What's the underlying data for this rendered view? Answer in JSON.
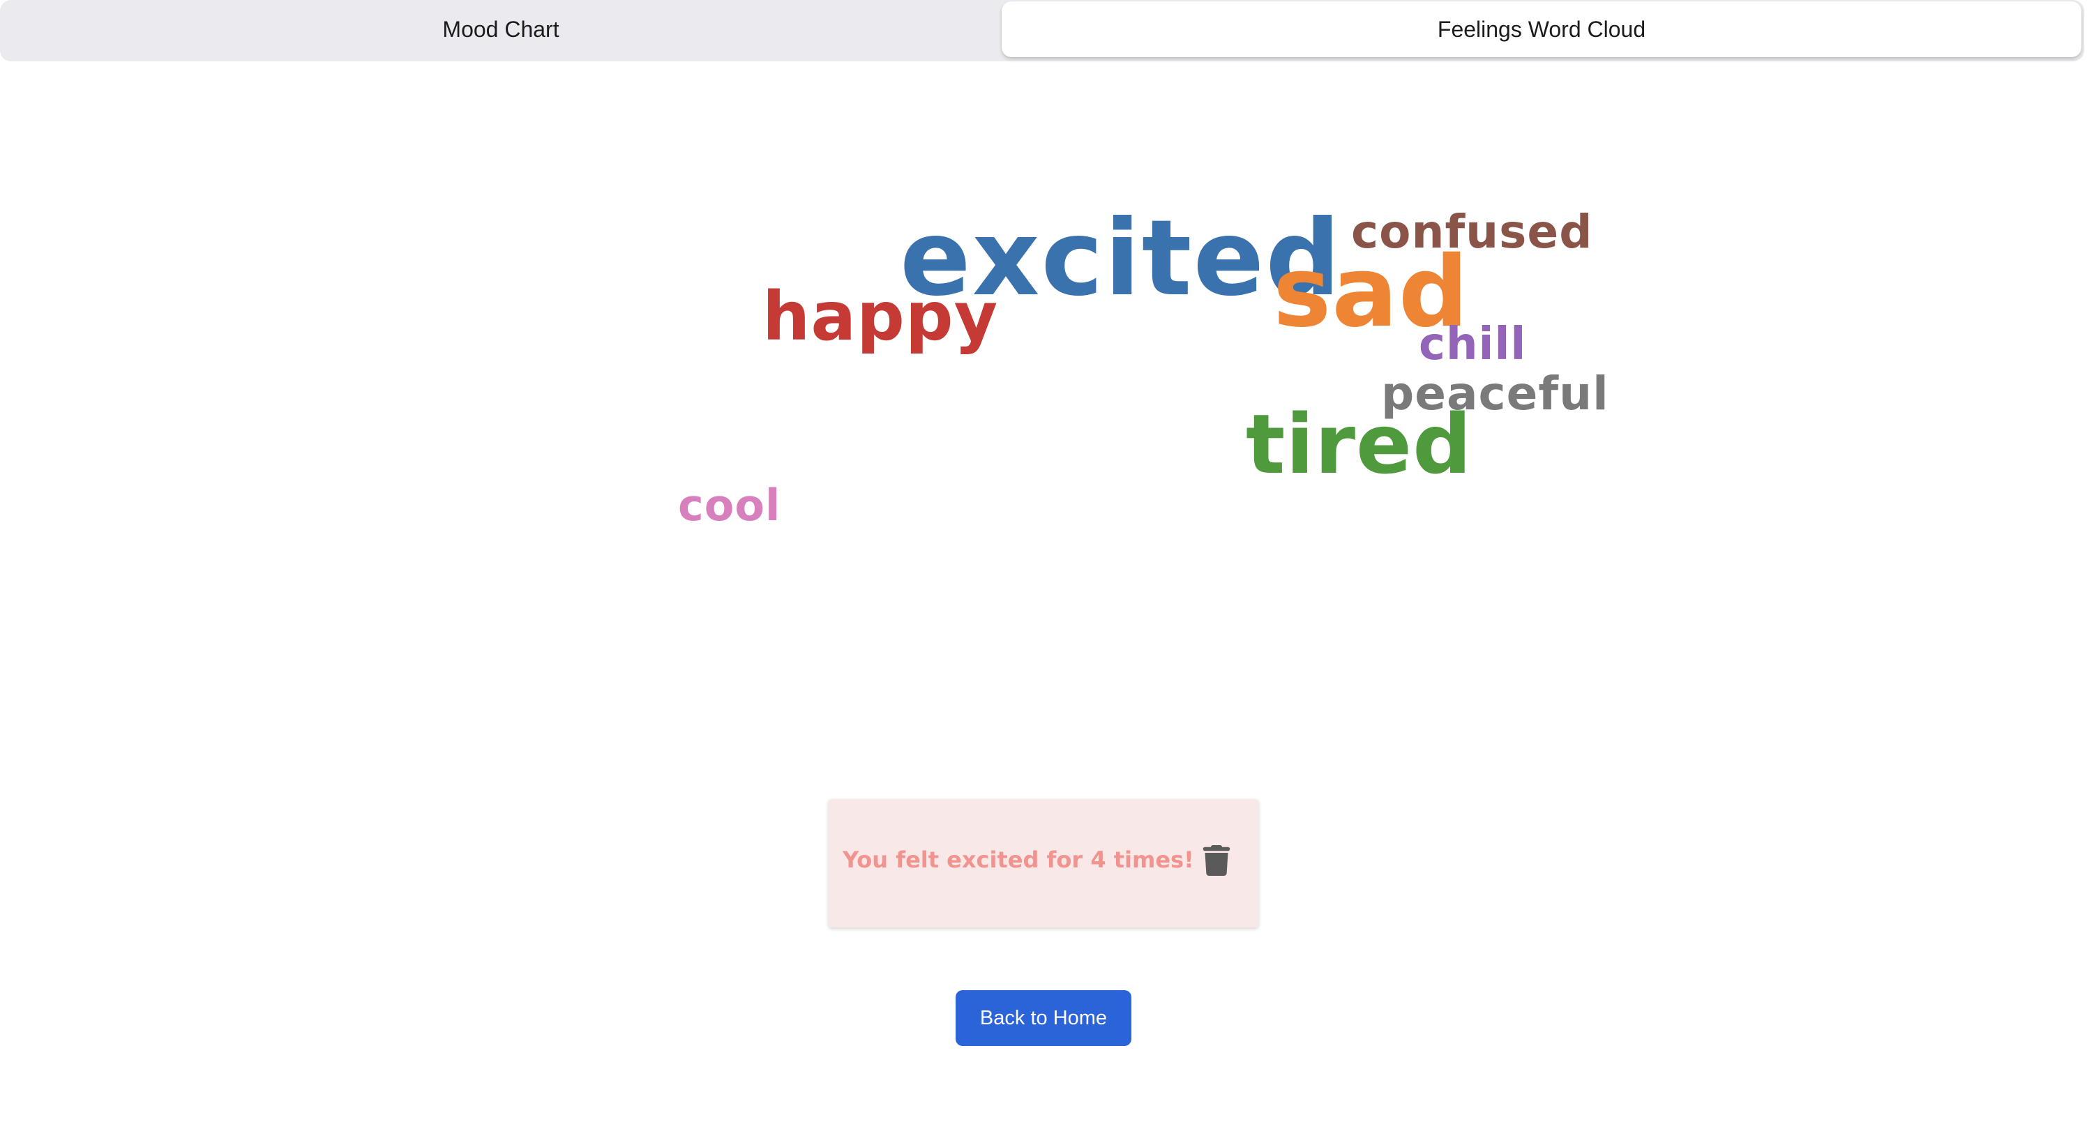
{
  "tabs": {
    "mood_chart": "Mood Chart",
    "word_cloud": "Feelings Word Cloud",
    "active": "word_cloud"
  },
  "word_cloud": {
    "words": [
      {
        "text": "excited",
        "color": "#3a72ae"
      },
      {
        "text": "sad",
        "color": "#ee8535"
      },
      {
        "text": "happy",
        "color": "#c53a35"
      },
      {
        "text": "confused",
        "color": "#8a5449"
      },
      {
        "text": "chill",
        "color": "#9364b7"
      },
      {
        "text": "peaceful",
        "color": "#7a7a7a"
      },
      {
        "text": "tired",
        "color": "#4f9a3d"
      },
      {
        "text": "cool",
        "color": "#d87fbd"
      }
    ]
  },
  "info_card": {
    "message": "You felt excited for 4 times!",
    "message_color": "#f1938f",
    "delete_icon": "trash-icon",
    "icon_color": "#5a5a5a"
  },
  "footer": {
    "home_button_label": "Back to Home",
    "home_button_color": "#2b63d8"
  }
}
